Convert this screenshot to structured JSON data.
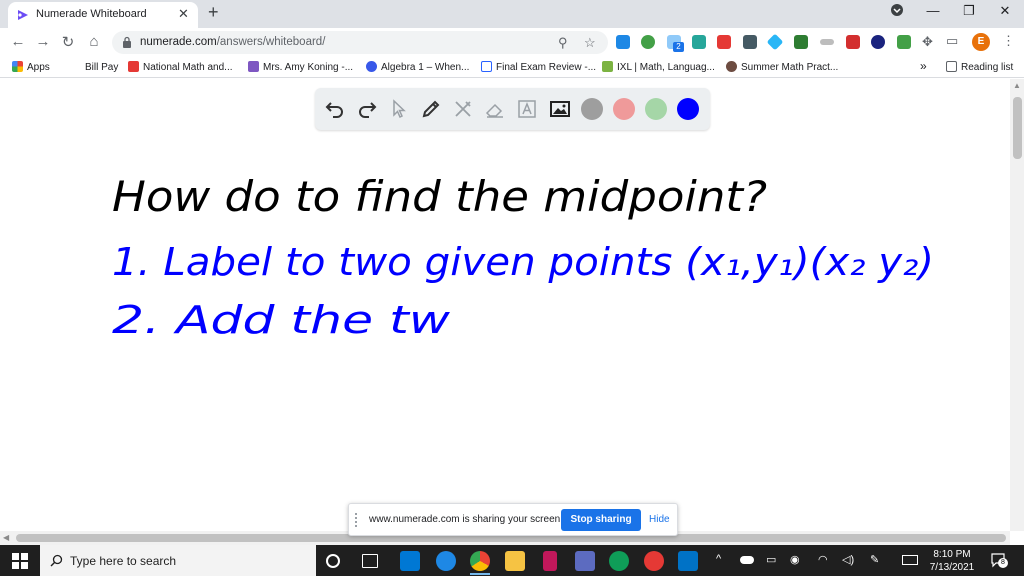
{
  "browser": {
    "tab": {
      "title": "Numerade Whiteboard",
      "close": "✕"
    },
    "new_tab": "+",
    "window_controls": {
      "profile_menu": "⌄",
      "minimize": "—",
      "restore": "❐",
      "close": "✕"
    },
    "nav": {
      "back": "←",
      "forward": "→",
      "reload": "↻",
      "home": "⌂"
    },
    "url": {
      "host": "numerade.com",
      "path": "/answers/whiteboard/"
    },
    "omnibox_icons": {
      "zoom": "⚲",
      "star": "☆"
    },
    "profile_initial": "E",
    "extension_badge": "2"
  },
  "bookmarks": {
    "items": [
      {
        "label": "Apps",
        "color": "#4285f4"
      },
      {
        "label": "Bill Pay",
        "color": "#ffffff"
      },
      {
        "label": "National Math and...",
        "color": "#e53935"
      },
      {
        "label": "Mrs. Amy Koning -...",
        "color": "#7e57c2"
      },
      {
        "label": "Algebra 1 – When...",
        "color": "#3858e9"
      },
      {
        "label": "Final Exam Review -...",
        "color": "#2962ff"
      },
      {
        "label": "IXL | Math, Languag...",
        "color": "#7cb342"
      },
      {
        "label": "Summer Math Pract...",
        "color": "#6d4c41"
      }
    ],
    "overflow": "»",
    "reading_list": "Reading list"
  },
  "whiteboard": {
    "tools": [
      "undo-icon",
      "redo-icon",
      "pointer-icon",
      "pen-icon",
      "tools-icon",
      "eraser-icon",
      "text-icon",
      "image-icon"
    ],
    "colors": [
      "#9e9e9e",
      "#ef9a9a",
      "#a5d6a7",
      "#0000ff"
    ],
    "lines": {
      "title": "How do to find the midpoint?",
      "step1": "1. Label to two given points (x₁,y₁)(x₂ y₂)",
      "step2": "2. Add the tw"
    }
  },
  "share_banner": {
    "message": "www.numerade.com is sharing your screen.",
    "stop_label": "Stop sharing",
    "hide_label": "Hide"
  },
  "taskbar": {
    "search_placeholder": "Type here to search",
    "time": "8:10 PM",
    "date": "7/13/2021",
    "notifications_count": "8",
    "tray_up": "^"
  }
}
